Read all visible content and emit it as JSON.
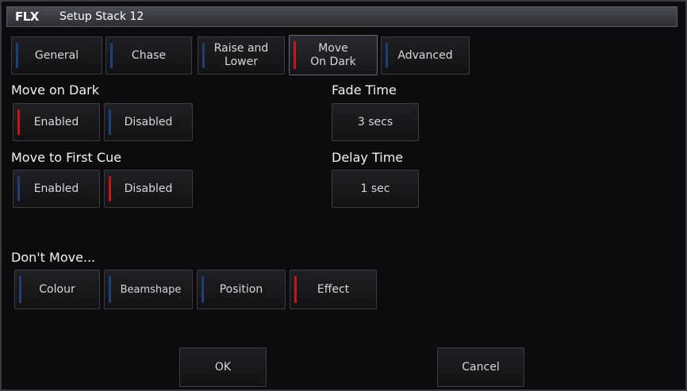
{
  "window": {
    "logo": "FLX",
    "title": "Setup Stack 12"
  },
  "tabs": [
    {
      "label": "General",
      "state": "off"
    },
    {
      "label": "Chase",
      "state": "off"
    },
    {
      "label": "Raise and Lower",
      "state": "off"
    },
    {
      "label": "Move On Dark",
      "state": "on"
    },
    {
      "label": "Advanced",
      "state": "off"
    }
  ],
  "move_on_dark": {
    "label": "Move on Dark",
    "options": [
      "Enabled",
      "Disabled"
    ],
    "selected": "Enabled"
  },
  "move_to_first_cue": {
    "label": "Move to First Cue",
    "options": [
      "Enabled",
      "Disabled"
    ],
    "selected": "Disabled"
  },
  "fade_time": {
    "label": "Fade Time",
    "value": "3 secs"
  },
  "delay_time": {
    "label": "Delay Time",
    "value": "1 sec"
  },
  "dont_move": {
    "label": "Don't Move...",
    "options": [
      "Colour",
      "Beamshape",
      "Position",
      "Effect"
    ],
    "selected": [
      "Effect"
    ]
  },
  "footer": {
    "ok_label": "OK",
    "cancel_label": "Cancel"
  },
  "colors": {
    "indicator_on": "#c11818",
    "indicator_off": "#1e3f77",
    "background": "#0c0c0e"
  }
}
